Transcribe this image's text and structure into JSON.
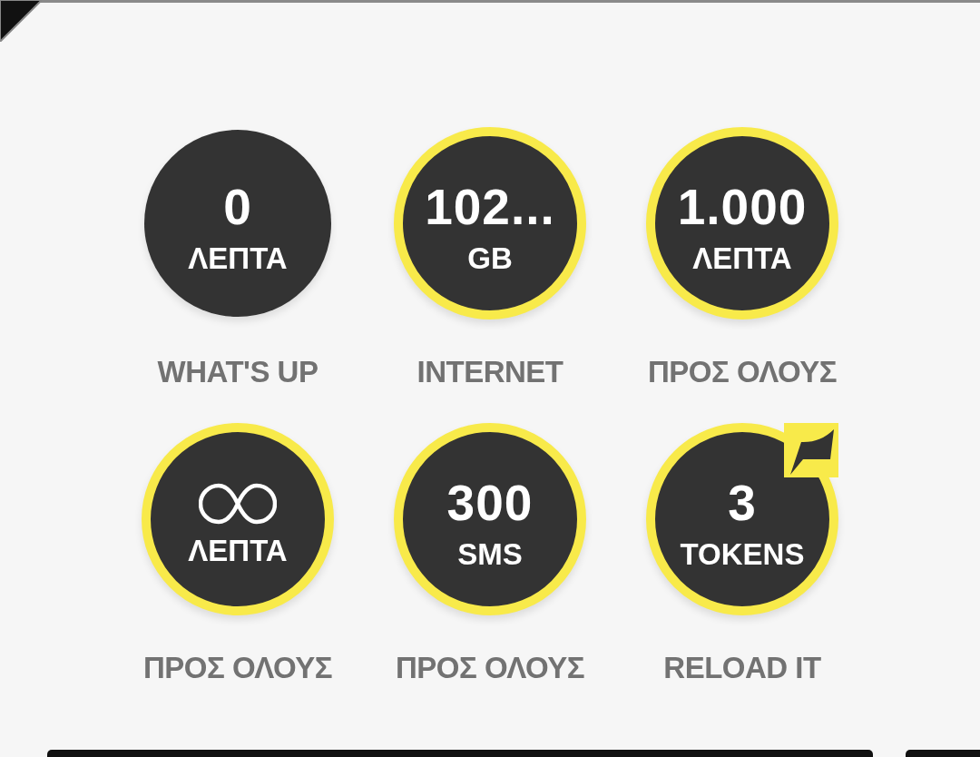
{
  "bundles": [
    {
      "kind": "number",
      "value": "0",
      "unit": "ΛΕΠΤΑ",
      "label": "WHAT'S UP",
      "ringed": false,
      "badge": false
    },
    {
      "kind": "number",
      "value": "102...",
      "unit": "GB",
      "label": "INTERNET",
      "ringed": true,
      "badge": false
    },
    {
      "kind": "number",
      "value": "1.000",
      "unit": "ΛΕΠΤΑ",
      "label": "ΠΡΟΣ ΟΛΟΥΣ",
      "ringed": true,
      "badge": false
    },
    {
      "kind": "unlimited",
      "unit": "ΛΕΠΤΑ",
      "label": "ΠΡΟΣ ΟΛΟΥΣ",
      "ringed": true,
      "badge": false
    },
    {
      "kind": "number",
      "value": "300",
      "unit": "SMS",
      "label": "ΠΡΟΣ ΟΛΟΥΣ",
      "ringed": true,
      "badge": false
    },
    {
      "kind": "number",
      "value": "3",
      "unit": "TOKENS",
      "label": "RELOAD IT",
      "ringed": true,
      "badge": true
    }
  ]
}
